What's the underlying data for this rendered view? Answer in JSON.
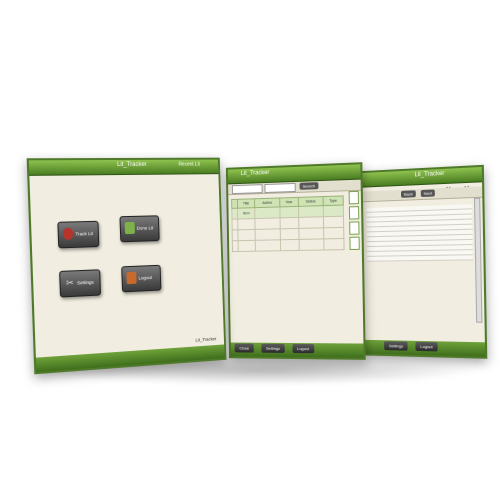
{
  "window1": {
    "title": "Lit_Tracker",
    "subtitle": "Recent Lit",
    "tiles": [
      {
        "label": "Track Lit",
        "icon": "dart-icon",
        "color": "#b5352c"
      },
      {
        "label": "Done Lit",
        "icon": "clipboard-check-icon",
        "color": "#7fb14a"
      },
      {
        "label": "Settings",
        "icon": "scissors-icon",
        "color": "#6e6e6e"
      },
      {
        "label": "Logout",
        "icon": "logout-icon",
        "color": "#c8692d"
      }
    ],
    "version": "Lit_Tracker"
  },
  "window2": {
    "title": "Lit_Tracker",
    "search_button": "Search",
    "columns": [
      "",
      "Title",
      "Author",
      "Year",
      "Status",
      "Type"
    ],
    "rows": [
      [
        "",
        "Item",
        "",
        "",
        "",
        ""
      ],
      [
        "",
        "",
        "",
        "",
        "",
        ""
      ],
      [
        "",
        "",
        "",
        "",
        "",
        ""
      ],
      [
        "",
        "",
        "",
        "",
        "",
        ""
      ]
    ],
    "buttons": [
      "Close",
      "Settings",
      "Logout"
    ]
  },
  "window3": {
    "title": "Lit_Tracker",
    "tab_labels": [
      "Back",
      "Next"
    ],
    "paragraphs": [
      "",
      "",
      "",
      "",
      ""
    ],
    "buttons": [
      "Settings",
      "Logout"
    ]
  },
  "colors": {
    "accent": "#4a7d22",
    "accent_light": "#8fc24e",
    "background": "#f1ede0"
  }
}
